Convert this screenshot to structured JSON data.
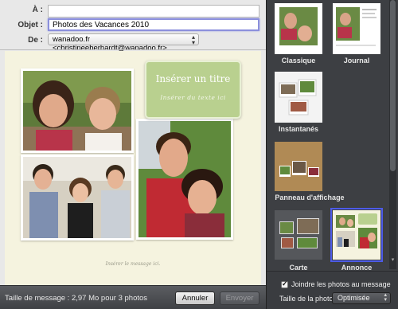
{
  "compose": {
    "to_label": "À :",
    "to_value": "",
    "subject_label": "Objet :",
    "subject_value": "Photos des Vacances 2010",
    "from_label": "De :",
    "from_value": "wanadoo.fr <christineeberhardt@wanadoo.fr>"
  },
  "stationery": {
    "title_placeholder": "Insérer un titre",
    "subtitle_placeholder": "Insérer du texte ici",
    "message_placeholder": "Insérer le message ici."
  },
  "statusbar": {
    "message_size": "Taille de message : 2,97 Mo pour 3 photos",
    "cancel_label": "Annuler",
    "send_label": "Envoyer"
  },
  "templates": [
    {
      "label": "Classique",
      "selected": false
    },
    {
      "label": "Journal",
      "selected": false
    },
    {
      "label": "Instantanés",
      "selected": false
    },
    {
      "label": "Panneau d'affichage",
      "selected": false
    },
    {
      "label": "Carte",
      "selected": false
    },
    {
      "label": "Annonce",
      "selected": true
    }
  ],
  "options": {
    "attach_label": "Joindre les photos au message",
    "attach_checked": true,
    "photo_size_label": "Taille de la photo :",
    "photo_size_value": "Optimisée"
  },
  "colors": {
    "title_card": "#b9d08f",
    "selection": "#4d5be8",
    "stationery_bg": "#f5f3df"
  }
}
